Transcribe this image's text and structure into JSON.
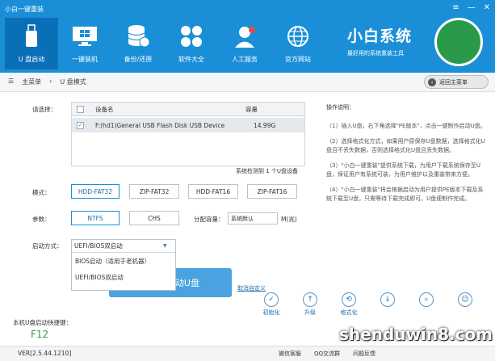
{
  "app": {
    "title": "小白一键重装",
    "controls": [
      "≡",
      "—",
      "✕"
    ]
  },
  "nav": [
    {
      "label": "U 盘启动",
      "icon": "usb-drive-icon"
    },
    {
      "label": "一键装机",
      "icon": "windows-icon"
    },
    {
      "label": "备份/还原",
      "icon": "database-icon"
    },
    {
      "label": "软件大全",
      "icon": "apps-icon"
    },
    {
      "label": "人工服务",
      "icon": "support-agent-icon"
    },
    {
      "label": "官方网站",
      "icon": "globe-icon"
    }
  ],
  "brand": {
    "name": "小白系统",
    "slogan": "最好用的系统重装工具"
  },
  "breadcrumb": {
    "home": "主菜单",
    "current": "U 盘模式"
  },
  "back_button": "返回主菜单",
  "device": {
    "label": "请选择：",
    "col_device": "设备名",
    "col_capacity": "容量",
    "rows": [
      {
        "name": "F:(hd1)General USB Flash Disk USB Device",
        "capacity": "14.99G",
        "checked": true
      }
    ],
    "status": "系统检测到 1 个U盘设备"
  },
  "mode": {
    "label": "模式：",
    "options": [
      "HDD-FAT32",
      "ZIP-FAT32",
      "HDD-FAT16",
      "ZIP-FAT16"
    ],
    "selected": "HDD-FAT32"
  },
  "params": {
    "label": "参数：",
    "options": [
      "NTFS",
      "CHS"
    ],
    "selected": "NTFS",
    "alloc_label": "分配容量：",
    "alloc_value": "系统默认",
    "unit": "M(兆)"
  },
  "boot": {
    "label": "启动方式：",
    "value": "UEFI/BIOS双启动",
    "options": [
      "BIOS启动（适用于老机器）",
      "UEFI/BIOS双启动"
    ]
  },
  "make_button": "动U盘",
  "advanced_link": "取消自定义",
  "help": {
    "title": "操作说明：",
    "items": [
      "（1）插入U盘，右下角选择\"PE版本\"，点击一键制作启动U盘。",
      "（2）选择格式化方式，如果用户原保存U盘数据，选择格式化U盘且不丢失数据，否则选择格式化U盘且丢失数据。",
      "（3）\"小白一键重装\"提供系统下载，为用户下载系统保存至U盘，保证用户有系统可装，为用户维护以及重装带来方便。",
      "（4）\"小白一键重装\"将会根据启动为用户提供PE版本下载及系统下载至U盘，只需等待下载完成即可。U盘便制作完成。"
    ]
  },
  "hotkey": {
    "label": "本机U盘启动快捷键：",
    "value": "F12"
  },
  "tools": [
    "初始化",
    "升级",
    "格式化",
    "",
    "",
    ""
  ],
  "footer": {
    "version": "VER[2.5.44.1210]",
    "social": [
      "微信客服",
      "QQ交流群",
      "问题反馈"
    ]
  },
  "watermark": "shenduwin8.com"
}
